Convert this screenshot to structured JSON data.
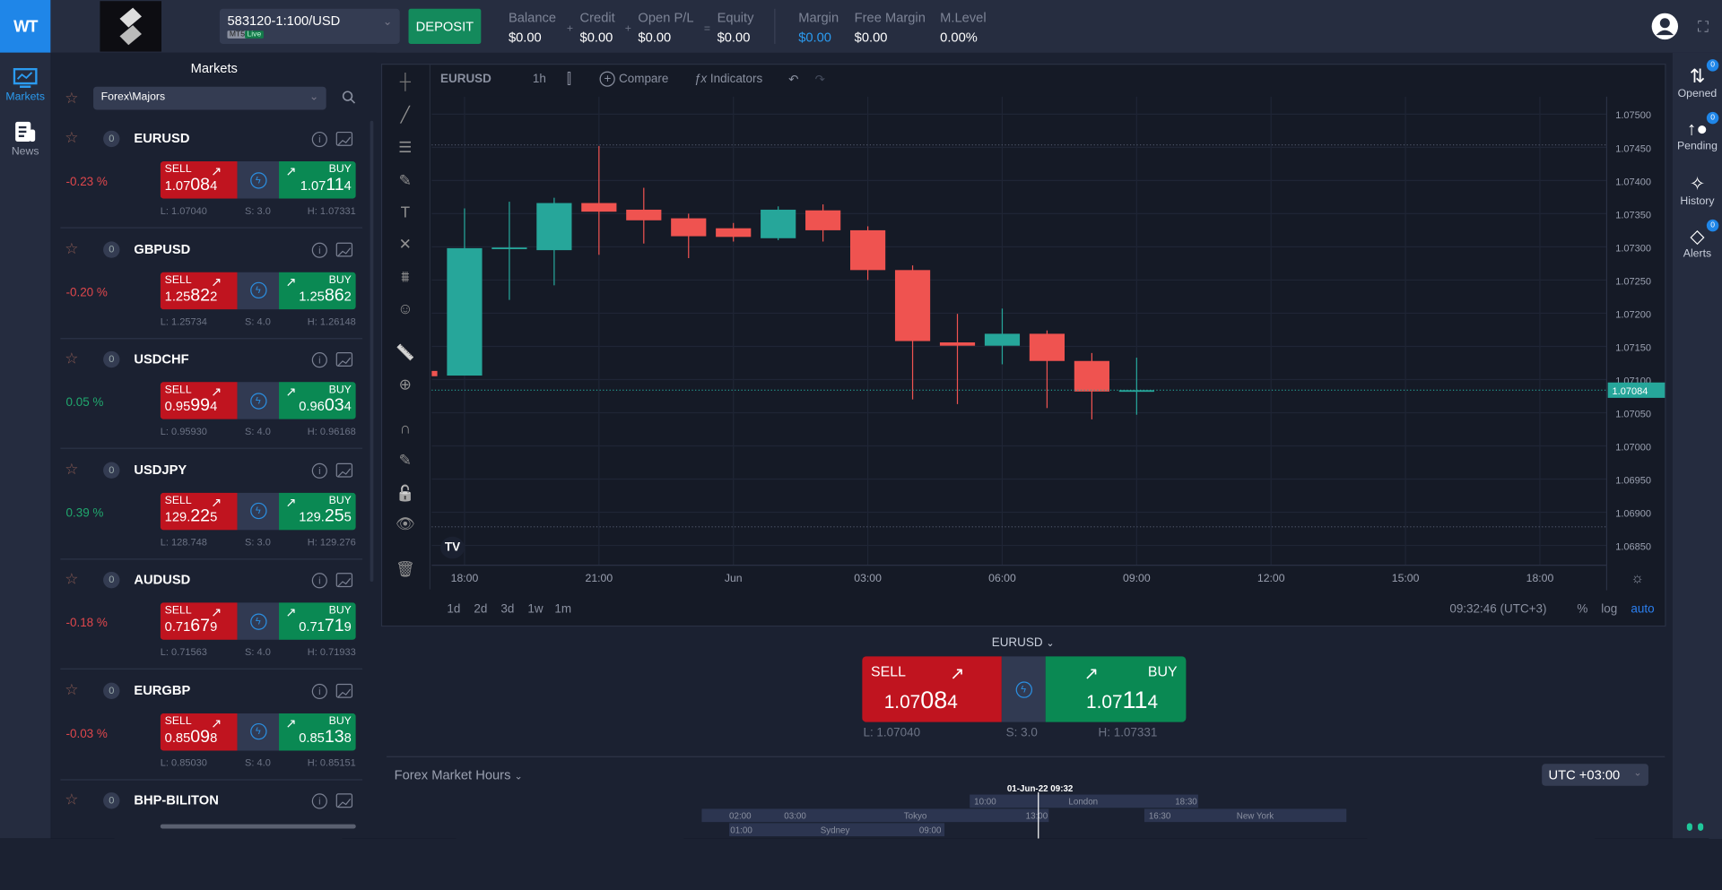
{
  "header": {
    "logo": "WT",
    "account": "583120-1:100/USD",
    "platform": "MT5",
    "mode": "Live",
    "deposit": "DEPOSIT",
    "stats": [
      {
        "label": "Balance",
        "value": "$0.00"
      },
      {
        "label": "Credit",
        "value": "$0.00"
      },
      {
        "label": "Open P/L",
        "value": "$0.00"
      },
      {
        "label": "Equity",
        "value": "$0.00"
      },
      {
        "label": "Margin",
        "value": "$0.00"
      },
      {
        "label": "Free Margin",
        "value": "$0.00"
      },
      {
        "label": "M.Level",
        "value": "0.00%"
      }
    ],
    "ops": [
      "+",
      "+",
      "="
    ]
  },
  "nav": {
    "markets": "Markets",
    "news": "News"
  },
  "markets": {
    "title": "Markets",
    "category": "Forex\\Majors",
    "items": [
      {
        "symbol": "EURUSD",
        "count": "0",
        "change": "-0.23 %",
        "dir": "down",
        "sell": {
          "pre": "1.07",
          "big": "08",
          "pip": "4"
        },
        "buy": {
          "pre": "1.07",
          "big": "11",
          "pip": "4"
        },
        "low": "L: 1.07040",
        "spread": "S: 3.0",
        "high": "H: 1.07331"
      },
      {
        "symbol": "GBPUSD",
        "count": "0",
        "change": "-0.20 %",
        "dir": "down",
        "sell": {
          "pre": "1.25",
          "big": "82",
          "pip": "2"
        },
        "buy": {
          "pre": "1.25",
          "big": "86",
          "pip": "2"
        },
        "low": "L: 1.25734",
        "spread": "S: 4.0",
        "high": "H: 1.26148"
      },
      {
        "symbol": "USDCHF",
        "count": "0",
        "change": "0.05 %",
        "dir": "up",
        "sell": {
          "pre": "0.95",
          "big": "99",
          "pip": "4"
        },
        "buy": {
          "pre": "0.96",
          "big": "03",
          "pip": "4"
        },
        "low": "L: 0.95930",
        "spread": "S: 4.0",
        "high": "H: 0.96168"
      },
      {
        "symbol": "USDJPY",
        "count": "0",
        "change": "0.39 %",
        "dir": "up",
        "sell": {
          "pre": "129.",
          "big": "22",
          "pip": "5"
        },
        "buy": {
          "pre": "129.",
          "big": "25",
          "pip": "5"
        },
        "low": "L: 128.748",
        "spread": "S: 3.0",
        "high": "H: 129.276"
      },
      {
        "symbol": "AUDUSD",
        "count": "0",
        "change": "-0.18 %",
        "dir": "down",
        "sell": {
          "pre": "0.71",
          "big": "67",
          "pip": "9"
        },
        "buy": {
          "pre": "0.71",
          "big": "71",
          "pip": "9"
        },
        "low": "L: 0.71563",
        "spread": "S: 4.0",
        "high": "H: 0.71933"
      },
      {
        "symbol": "EURGBP",
        "count": "0",
        "change": "-0.03 %",
        "dir": "down",
        "sell": {
          "pre": "0.85",
          "big": "09",
          "pip": "8"
        },
        "buy": {
          "pre": "0.85",
          "big": "13",
          "pip": "8"
        },
        "low": "L: 0.85030",
        "spread": "S: 4.0",
        "high": "H: 0.85151"
      },
      {
        "symbol": "BHP-BILITON",
        "count": "0"
      }
    ],
    "sell_label": "SELL",
    "buy_label": "BUY"
  },
  "chart_toolbar": {
    "symbol": "EURUSD",
    "interval": "1h",
    "compare": "Compare",
    "indicators": "Indicators"
  },
  "chart_footer": {
    "ranges": [
      "1d",
      "2d",
      "3d",
      "1w",
      "1m"
    ],
    "time": "09:32:46 (UTC+3)",
    "pct": "%",
    "log": "log",
    "auto": "auto"
  },
  "chart_data": {
    "type": "candlestick",
    "symbol": "EURUSD",
    "interval": "1h",
    "x_ticks": [
      "18:00",
      "21:00",
      "Jun",
      "03:00",
      "06:00",
      "09:00",
      "12:00",
      "15:00",
      "18:00"
    ],
    "y_ticks": [
      "1.07500",
      "1.07450",
      "1.07400",
      "1.07350",
      "1.07300",
      "1.07250",
      "1.07200",
      "1.07150",
      "1.07100",
      "1.07050",
      "1.07000",
      "1.06950",
      "1.06900",
      "1.06850"
    ],
    "ylim": [
      1.06825,
      1.0754
    ],
    "last_price": "1.07084",
    "candles": [
      {
        "t": "17:00",
        "o": 1.07113,
        "h": 1.0712,
        "l": 1.071,
        "c": 1.07105
      },
      {
        "t": "18:00",
        "o": 1.07106,
        "h": 1.07358,
        "l": 1.07106,
        "c": 1.07298
      },
      {
        "t": "19:00",
        "o": 1.07298,
        "h": 1.07368,
        "l": 1.0722,
        "c": 1.07299
      },
      {
        "t": "20:00",
        "o": 1.07295,
        "h": 1.07374,
        "l": 1.07242,
        "c": 1.07366
      },
      {
        "t": "21:00",
        "o": 1.07366,
        "h": 1.07452,
        "l": 1.07288,
        "c": 1.07353
      },
      {
        "t": "22:00",
        "o": 1.07356,
        "h": 1.07389,
        "l": 1.07305,
        "c": 1.0734
      },
      {
        "t": "23:00",
        "o": 1.07343,
        "h": 1.0735,
        "l": 1.07283,
        "c": 1.07316
      },
      {
        "t": "00:00",
        "o": 1.07328,
        "h": 1.07336,
        "l": 1.07308,
        "c": 1.07315
      },
      {
        "t": "01:00",
        "o": 1.07313,
        "h": 1.07361,
        "l": 1.0731,
        "c": 1.07356
      },
      {
        "t": "02:00",
        "o": 1.07355,
        "h": 1.07364,
        "l": 1.07308,
        "c": 1.07325
      },
      {
        "t": "03:00",
        "o": 1.07325,
        "h": 1.07331,
        "l": 1.0725,
        "c": 1.07265
      },
      {
        "t": "04:00",
        "o": 1.07265,
        "h": 1.07272,
        "l": 1.0707,
        "c": 1.07158
      },
      {
        "t": "05:00",
        "o": 1.07156,
        "h": 1.07199,
        "l": 1.07063,
        "c": 1.07151
      },
      {
        "t": "06:00",
        "o": 1.07151,
        "h": 1.07207,
        "l": 1.07123,
        "c": 1.07169
      },
      {
        "t": "07:00",
        "o": 1.07169,
        "h": 1.07174,
        "l": 1.07057,
        "c": 1.07128
      },
      {
        "t": "08:00",
        "o": 1.07128,
        "h": 1.0714,
        "l": 1.0704,
        "c": 1.07082
      },
      {
        "t": "09:00",
        "o": 1.07084,
        "h": 1.07133,
        "l": 1.07047,
        "c": 1.07084
      }
    ],
    "colors": {
      "up": "#26a69a",
      "down": "#ef5350"
    }
  },
  "trade": {
    "symbol": "EURUSD",
    "sell_label": "SELL",
    "buy_label": "BUY",
    "sell": {
      "pre": "1.07",
      "big": "08",
      "pip": "4"
    },
    "buy": {
      "pre": "1.07",
      "big": "11",
      "pip": "4"
    },
    "low": "L: 1.07040",
    "spread": "S: 3.0",
    "high": "H: 1.07331"
  },
  "market_hours": {
    "title": "Forex Market Hours",
    "timezone": "UTC +03:00",
    "now": "01-Jun-22 09:32",
    "london": {
      "name": "London",
      "open": "10:00",
      "close": "18:30"
    },
    "tokyo": {
      "name": "Tokyo",
      "pre": "02:00",
      "open": "03:00",
      "close": "13:00"
    },
    "newyork": {
      "name": "New York",
      "open": "16:30"
    },
    "sydney": {
      "name": "Sydney",
      "open": "01:00",
      "close": "09:00"
    }
  },
  "right_sidebar": [
    {
      "label": "Opened",
      "count": "0"
    },
    {
      "label": "Pending",
      "count": "0"
    },
    {
      "label": "History"
    },
    {
      "label": "Alerts",
      "count": "0"
    }
  ],
  "colors": {
    "accent": "#1f86e8",
    "sell": "#c0141f",
    "buy": "#0a8953",
    "down_text": "#e0474c",
    "up_text": "#20a86e"
  }
}
